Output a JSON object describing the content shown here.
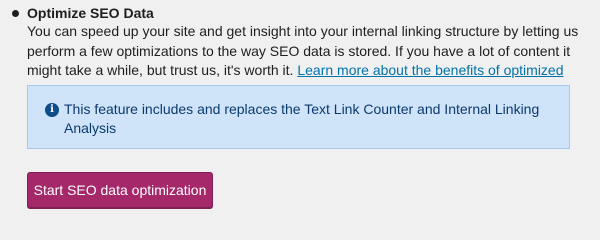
{
  "section": {
    "title": "Optimize SEO Data",
    "description": "You can speed up your site and get insight into your internal linking structure by letting us perform a few optimizations to the way SEO data is stored. If you have a lot of content it might take a while, but trust us, it's worth it.",
    "learn_more_link": "Learn more about the benefits of optimized SEO data."
  },
  "notice": {
    "icon": "info-icon",
    "text": "This feature includes and replaces the Text Link Counter and Internal Linking Analysis"
  },
  "button": {
    "label": "Start SEO data optimization"
  },
  "colors": {
    "background": "#f0f0f1",
    "notice_background": "#cfe3f9",
    "notice_text": "#0b3a6e",
    "link": "#0073aa",
    "button": "#a4286a"
  }
}
